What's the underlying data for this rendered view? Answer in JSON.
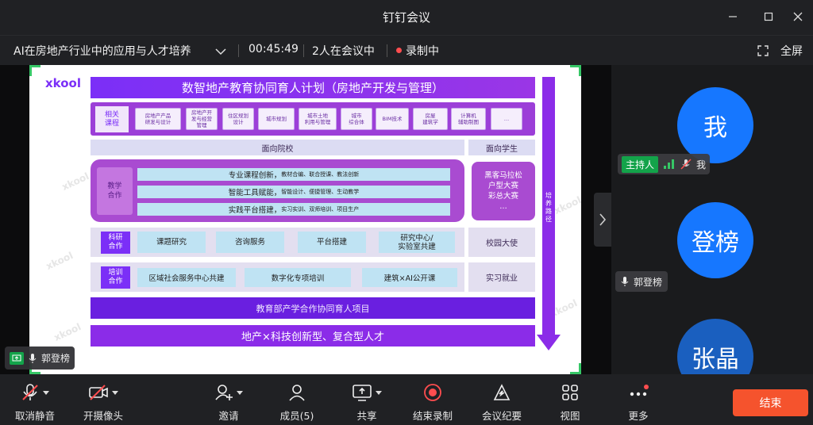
{
  "window": {
    "title": "钉钉会议"
  },
  "meeting": {
    "topic": "AI在房地产行业中的应用与人才培养",
    "duration": "00:45:49",
    "participants_status": "2人在会议中",
    "recording_status": "录制中",
    "fullscreen_label": "全屏"
  },
  "slide": {
    "logo": "xkool",
    "watermark": "xkool",
    "title": "数智地产教育协同育人计划（房地产开发与管理）",
    "courses_label": "相关\n课程",
    "courses": [
      "房地产产品\n研发与设计",
      "房地产开\n发与经营\n管理",
      "住区规划\n设计",
      "城市规划",
      "城市土地\n利用与管理",
      "城市\n综合体",
      "BIM技术",
      "房屋\n建筑学",
      "计算机\n辅助制图",
      "…"
    ],
    "college_header": "面向院校",
    "student_header": "面向学生",
    "teaching_label": "教学\n合作",
    "teaching_items": [
      {
        "title": "专业课程创新，",
        "detail": "教材合编、联合授课、教法创新"
      },
      {
        "title": "智能工具赋能，",
        "detail": "智能设计、便捷管理、生动教学"
      },
      {
        "title": "实践平台搭建，",
        "detail": "实习实训、双师培训、项目生产"
      }
    ],
    "competition": "黑客马拉松\n户型大赛\n彩总大赛\n…",
    "research_label": "科研\n合作",
    "research_items": [
      "课题研究",
      "咨询服务",
      "平台搭建",
      "研究中心/\n实验室共建"
    ],
    "ambassador": "校园大使",
    "training_label": "培训\n合作",
    "training_items": [
      "区域社会服务中心共建",
      "数字化专项培训",
      "建筑×AI公开课"
    ],
    "internship": "实习就业",
    "ministry_project": "教育部产学合作协同育人项目",
    "talent_goal": "地产×科技创新型、复合型人才",
    "path_label": "培\n养\n路\n径"
  },
  "participants": [
    {
      "avatar_text": "我",
      "role": "主持人",
      "name": "我"
    },
    {
      "avatar_text": "登榜",
      "name": "郭登榜"
    },
    {
      "avatar_text": "张晶"
    }
  ],
  "sharer_tag": "郭登榜",
  "toolbar": {
    "unmute": "取消静音",
    "camera": "开摄像头",
    "invite": "邀请",
    "members": "成员(5)",
    "share": "共享",
    "end_recording": "结束录制",
    "minutes": "会议纪要",
    "view": "视图",
    "more": "更多",
    "end": "结束"
  },
  "colors": {
    "accent": "#1677ff",
    "end": "#f5532d",
    "slide_purple": "#7b2ff7",
    "recording": "#ff4d4f",
    "host_badge": "#13a34a"
  }
}
